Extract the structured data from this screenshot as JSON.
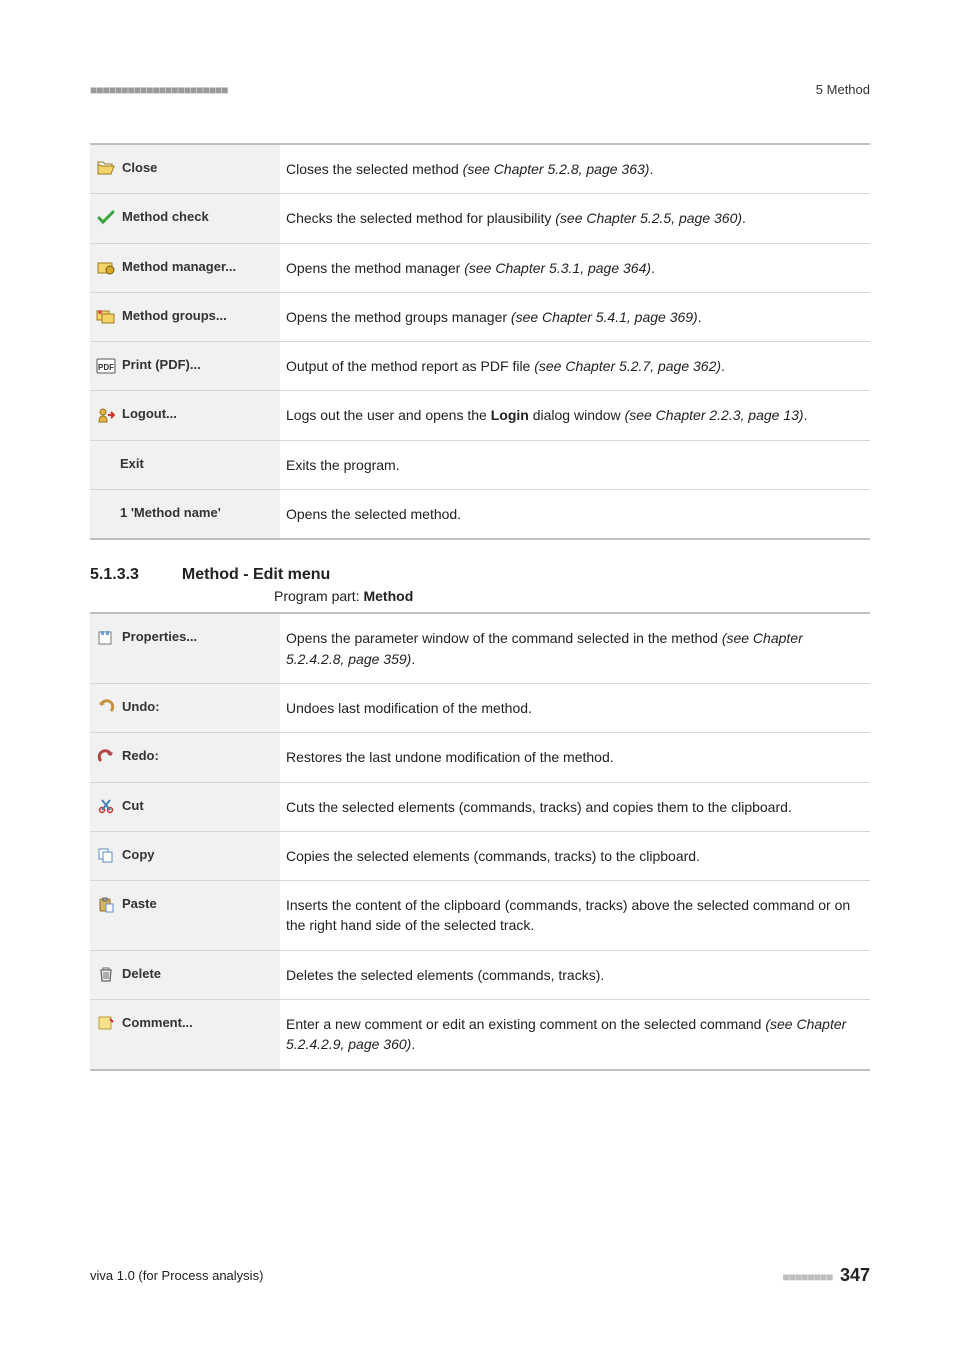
{
  "header": {
    "bars": "■■■■■■■■■■■■■■■■■■■■■■",
    "chapter": "5 Method"
  },
  "table1": {
    "rows": [
      {
        "icon": "folder-open-icon",
        "label": "Close",
        "desc_pre": "Closes the selected method ",
        "desc_ital": "(see Chapter 5.2.8, page 363)",
        "desc_post": "."
      },
      {
        "icon": "checkmark-icon",
        "label": "Method check",
        "desc_pre": "Checks the selected method for plausibility ",
        "desc_ital": "(see Chapter 5.2.5, page 360)",
        "desc_post": "."
      },
      {
        "icon": "folder-gear-icon",
        "label": "Method manager...",
        "desc_pre": "Opens the method manager ",
        "desc_ital": "(see Chapter 5.3.1, page 364)",
        "desc_post": "."
      },
      {
        "icon": "folders-icon",
        "label": "Method groups...",
        "desc_pre": "Opens the method groups manager ",
        "desc_ital": "(see Chapter 5.4.1, page 369)",
        "desc_post": "."
      },
      {
        "icon": "pdf-icon",
        "label": "Print (PDF)...",
        "desc_pre": "Output of the method report as PDF file ",
        "desc_ital": "(see Chapter 5.2.7, page 362)",
        "desc_post": "."
      },
      {
        "icon": "logout-icon",
        "label": "Logout...",
        "desc_pre": "Logs out the user and opens the ",
        "desc_bold": "Login",
        "desc_mid": " dialog window ",
        "desc_ital": "(see Chapter 2.2.3, page 13)",
        "desc_post": "."
      },
      {
        "icon": "",
        "label": "Exit",
        "desc_pre": "Exits the program."
      },
      {
        "icon": "",
        "label": "1 'Method name'",
        "desc_pre": "Opens the selected method."
      }
    ]
  },
  "section": {
    "number": "5.1.3.3",
    "title": "Method - Edit menu",
    "program_part_label": "Program part: ",
    "program_part_value": "Method"
  },
  "table2": {
    "rows": [
      {
        "icon": "properties-icon",
        "label": "Properties...",
        "desc_pre": "Opens the parameter window of the command selected in the method ",
        "desc_ital": "(see Chapter 5.2.4.2.8, page 359)",
        "desc_post": "."
      },
      {
        "icon": "undo-icon",
        "label": "Undo:",
        "desc_pre": "Undoes last modification of the method."
      },
      {
        "icon": "redo-icon",
        "label": "Redo:",
        "desc_pre": "Restores the last undone modification of the method."
      },
      {
        "icon": "cut-icon",
        "label": "Cut",
        "desc_pre": "Cuts the selected elements (commands, tracks) and copies them to the clipboard."
      },
      {
        "icon": "copy-icon",
        "label": "Copy",
        "desc_pre": "Copies the selected elements (commands, tracks) to the clipboard."
      },
      {
        "icon": "paste-icon",
        "label": "Paste",
        "desc_pre": "Inserts the content of the clipboard (commands, tracks) above the selected command or on the right hand side of the selected track."
      },
      {
        "icon": "delete-icon",
        "label": "Delete",
        "desc_pre": "Deletes the selected elements (commands, tracks)."
      },
      {
        "icon": "comment-icon",
        "label": "Comment...",
        "desc_pre": "Enter a new comment or edit an existing comment on the selected command ",
        "desc_ital": "(see Chapter 5.2.4.2.9, page 360)",
        "desc_post": "."
      }
    ]
  },
  "footer": {
    "left": "viva 1.0 (for Process analysis)",
    "bars": "■■■■■■■■",
    "page": "347"
  },
  "icons": {
    "folder-open-icon": "<svg width='18' height='16' viewBox='0 0 18 16'><path d='M1 4 L1 14 L14 14 L17 6 L4 6 Z' fill='#f5d469' stroke='#9b7a1f' stroke-width='1'/><path d='M1 4 L1 2 L6 2 L8 4 L15 4 L15 6' fill='none' stroke='#9b7a1f'/></svg>",
    "checkmark-icon": "<svg width='18' height='16' viewBox='0 0 18 16'><path d='M2 8 L6 12 L16 2' fill='none' stroke='#3aa43a' stroke-width='3' stroke-linecap='round'/></svg>",
    "folder-gear-icon": "<svg width='18' height='16' viewBox='0 0 18 16'><rect x='1' y='4' width='14' height='10' fill='#f5d469' stroke='#9b7a1f'/><circle cx='13' cy='11' r='4' fill='#d9a824' stroke='#7a5c12'/></svg>",
    "folders-icon": "<svg width='20' height='16' viewBox='0 0 20 16'><rect x='1' y='3' width='12' height='9' fill='#f5d469' stroke='#9b7a1f'/><rect x='6' y='6' width='12' height='9' fill='#f5d469' stroke='#9b7a1f'/><circle cx='4' cy='4' r='2' fill='#d9534f'/></svg>",
    "pdf-icon": "<svg width='20' height='16' viewBox='0 0 20 16'><rect x='1' y='1' width='18' height='14' rx='1' fill='#fff' stroke='#555'/><text x='10' y='12' font-size='8' font-family='Arial' text-anchor='middle' fill='#333' font-weight='bold'>PDF</text></svg>",
    "logout-icon": "<svg width='18' height='16' viewBox='0 0 18 16'><circle cx='6' cy='5' r='3' fill='#e6b54a' stroke='#9b7a1f'/><path d='M2 15 Q2 9 6 9 Q10 9 10 15 Z' fill='#e6b54a' stroke='#9b7a1f'/><path d='M11 8 L17 8 M14 5 L17 8 L14 11' fill='none' stroke='#c33' stroke-width='2'/></svg>",
    "properties-icon": "<svg width='18' height='16' viewBox='0 0 18 16'><rect x='2' y='2' width='12' height='12' fill='#fff' stroke='#777'/><rect x='4' y='1' width='3' height='4' fill='#6aa0d8'/><rect x='9' y='1' width='3' height='4' fill='#6aa0d8'/></svg>",
    "undo-icon": "<svg width='18' height='16' viewBox='0 0 18 16'><path d='M14 12 A6 6 0 1 0 4 6' fill='none' stroke='#c7923e' stroke-width='3'/><path d='M2 3 L4 7 L8 5 Z' fill='#c7923e'/></svg>",
    "redo-icon": "<svg width='18' height='16' viewBox='0 0 18 16'><path d='M4 12 A6 6 0 1 1 14 6' fill='none' stroke='#b74444' stroke-width='3'/><path d='M16 3 L14 7 L10 5 Z' fill='#b74444'/></svg>",
    "cut-icon": "<svg width='18' height='16' viewBox='0 0 18 16'><circle cx='5' cy='12' r='2.5' fill='none' stroke='#c33' stroke-width='1.5'/><circle cx='13' cy='12' r='2.5' fill='none' stroke='#c33' stroke-width='1.5'/><path d='M5 12 L13 2 M13 12 L5 2' stroke='#4a7fb5' stroke-width='2'/></svg>",
    "copy-icon": "<svg width='18' height='16' viewBox='0 0 18 16'><rect x='2' y='2' width='9' height='10' fill='#fff' stroke='#5a8bc4'/><rect x='6' y='5' width='9' height='10' fill='#fff' stroke='#5a8bc4'/></svg>",
    "paste-icon": "<svg width='18' height='16' viewBox='0 0 18 16'><rect x='3' y='2' width='10' height='12' rx='1' fill='#d8b46a' stroke='#8a6a2a'/><rect x='6' y='1' width='4' height='3' fill='#aaa' stroke='#666'/><rect x='9' y='7' width='7' height='8' fill='#fff' stroke='#5a8bc4'/></svg>",
    "delete-icon": "<svg width='18' height='16' viewBox='0 0 18 16'><path d='M4 4 L14 4 L13 15 L5 15 Z' fill='none' stroke='#666' stroke-width='1.3'/><path d='M6 2 L12 2 L12 4 L6 4 Z M7 6 L7 13 M9 6 L9 13 M11 6 L11 13' fill='none' stroke='#666'/></svg>",
    "comment-icon": "<svg width='18' height='16' viewBox='0 0 18 16'><rect x='2' y='2' width='12' height='12' fill='#f7e28b' stroke='#b89b2f'/><path d='M12 12 L14 14 L14 12 Z' fill='#d4b84a'/><path d='M13 4 L16 7' stroke='#c33' stroke-width='2'/></svg>"
  }
}
